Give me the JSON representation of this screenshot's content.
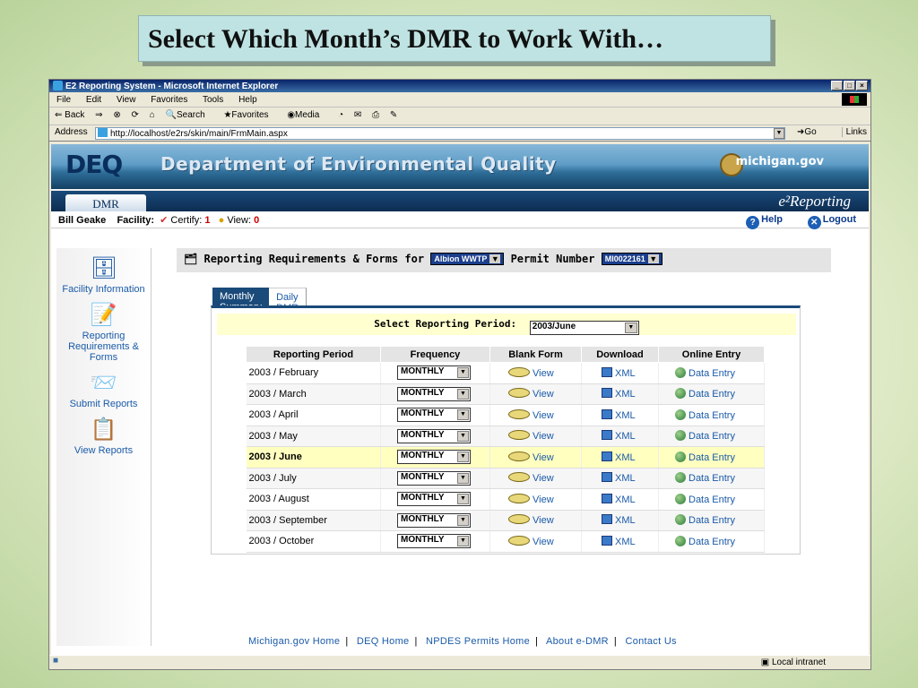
{
  "slide": {
    "title": "Select Which Month’s DMR to Work With…"
  },
  "browser": {
    "window_title": "E2 Reporting System - Microsoft Internet Explorer",
    "menu": [
      "File",
      "Edit",
      "View",
      "Favorites",
      "Tools",
      "Help"
    ],
    "toolbar": {
      "back": "⇐ Back",
      "forward": "⇒",
      "search": "Search",
      "favorites": "Favorites",
      "media": "Media"
    },
    "address_label": "Address",
    "url": "http://localhost/e2rs/skin/main/FrmMain.aspx",
    "go": "Go",
    "links": "Links",
    "status_zone": "Local intranet"
  },
  "app": {
    "logo": "DEQ",
    "header_title": "Department of Environmental Quality",
    "michigan": "michigan.gov",
    "tab_dmr": "DMR",
    "ereporting": "e²Reporting",
    "user": "Bill Geake",
    "facility_label": "Facility:",
    "certify_label": "Certify:",
    "certify_count": "1",
    "view_label": "View:",
    "view_count": "0",
    "help": "Help",
    "logout": "Logout"
  },
  "sidebar": {
    "items": [
      {
        "label": "Facility Information",
        "icon": "file-cabinet-icon"
      },
      {
        "label": "Reporting Requirements & Forms",
        "icon": "checklist-icon"
      },
      {
        "label": "Submit Reports",
        "icon": "submit-icon"
      },
      {
        "label": "View Reports",
        "icon": "view-reports-icon"
      }
    ]
  },
  "main": {
    "req_prefix": "Reporting Requirements & Forms for",
    "facility_select": "Albion WWTP",
    "permit_label": "Permit Number",
    "permit_select": "MI0022161",
    "tabs": [
      "Monthly Summary DMR",
      "Daily DMR"
    ],
    "period_label": "Select Reporting Period:",
    "period_value": "2003/June",
    "columns": [
      "Reporting Period",
      "Frequency",
      "Blank Form",
      "Download",
      "Online Entry"
    ],
    "rows": [
      {
        "period": "2003 / February",
        "freq": "MONTHLY",
        "blank": "View",
        "download": "XML",
        "entry": "Data Entry"
      },
      {
        "period": "2003 / March",
        "freq": "MONTHLY",
        "blank": "View",
        "download": "XML",
        "entry": "Data Entry"
      },
      {
        "period": "2003 / April",
        "freq": "MONTHLY",
        "blank": "View",
        "download": "XML",
        "entry": "Data Entry"
      },
      {
        "period": "2003 / May",
        "freq": "MONTHLY",
        "blank": "View",
        "download": "XML",
        "entry": "Data Entry"
      },
      {
        "period": "2003 / June",
        "freq": "MONTHLY",
        "blank": "View",
        "download": "XML",
        "entry": "Data Entry"
      },
      {
        "period": "2003 / July",
        "freq": "MONTHLY",
        "blank": "View",
        "download": "XML",
        "entry": "Data Entry"
      },
      {
        "period": "2003 / August",
        "freq": "MONTHLY",
        "blank": "View",
        "download": "XML",
        "entry": "Data Entry"
      },
      {
        "period": "2003 / September",
        "freq": "MONTHLY",
        "blank": "View",
        "download": "XML",
        "entry": "Data Entry"
      },
      {
        "period": "2003 / October",
        "freq": "MONTHLY",
        "blank": "View",
        "download": "XML",
        "entry": "Data Entry"
      }
    ],
    "highlight_period": "2003 / June"
  },
  "footer": {
    "links": [
      "Michigan.gov Home",
      "DEQ Home",
      "NPDES Permits Home",
      "About e-DMR",
      "Contact Us"
    ]
  }
}
